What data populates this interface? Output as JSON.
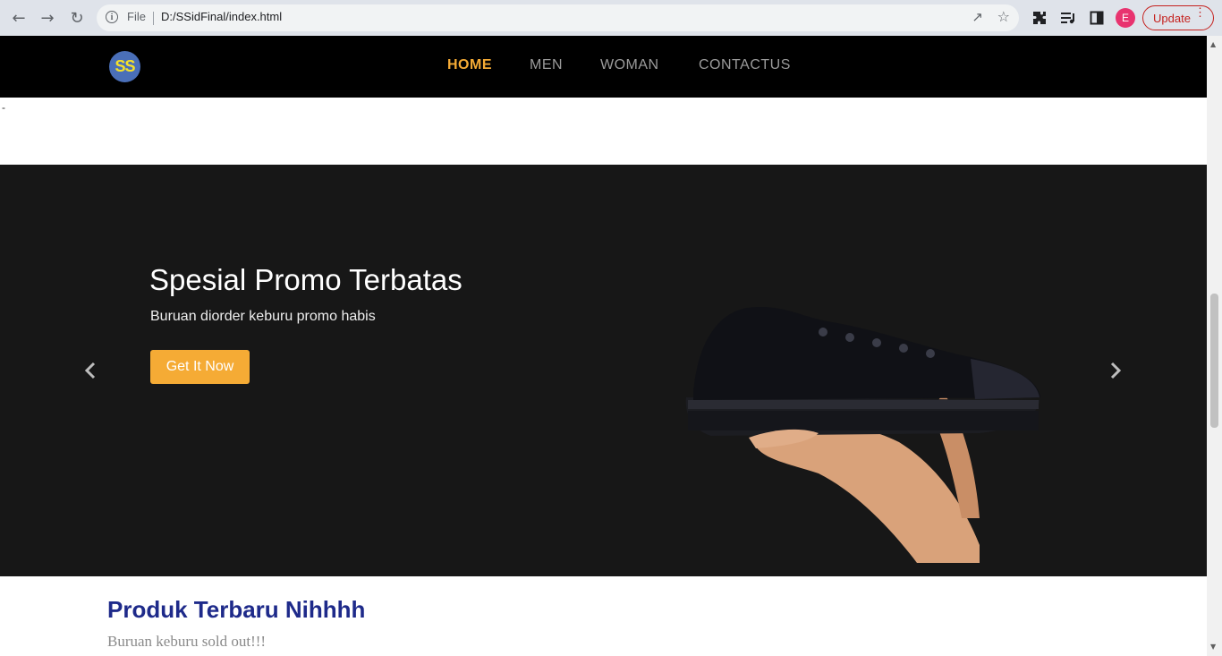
{
  "browser": {
    "file_label": "File",
    "url": "D:/SSidFinal/index.html",
    "profile_initial": "E",
    "update_label": "Update"
  },
  "site": {
    "logo_text": "SS",
    "menu": [
      {
        "label": "HOME",
        "active": true
      },
      {
        "label": "MEN",
        "active": false
      },
      {
        "label": "WOMAN",
        "active": false
      },
      {
        "label": "CONTACTUS",
        "active": false
      }
    ],
    "stray_text": "-"
  },
  "hero": {
    "title": "Spesial Promo Terbatas",
    "subtitle": "Buruan diorder keburu promo habis",
    "cta": "Get It Now"
  },
  "products": {
    "title": "Produk Terbaru Nihhhh",
    "subtitle": "Buruan keburu sold out!!!"
  },
  "colors": {
    "accent": "#f5ab35",
    "nav_bg": "#000000",
    "hero_bg": "#171717",
    "heading": "#1e2a8a"
  }
}
